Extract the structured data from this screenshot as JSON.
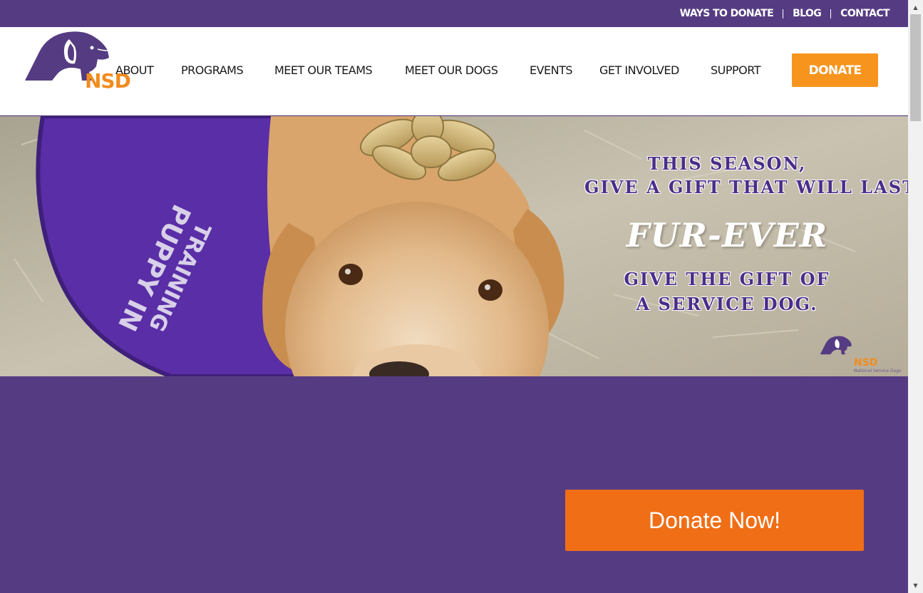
{
  "brand": {
    "logo_text": "NSD",
    "hero_logo_text": "NSD",
    "hero_logo_subtext": "National Service Dogs",
    "colors": {
      "purple": "#553c82",
      "orange": "#f7941d",
      "cta_orange": "#f06e16"
    }
  },
  "utility_nav": {
    "items": [
      {
        "label": "WAYS TO DONATE"
      },
      {
        "label": "BLOG"
      },
      {
        "label": "CONTACT"
      }
    ]
  },
  "main_nav": {
    "items": [
      {
        "label": "ABOUT"
      },
      {
        "label": "PROGRAMS"
      },
      {
        "label": "MEET OUR TEAMS"
      },
      {
        "label": "MEET OUR DOGS"
      },
      {
        "label": "EVENTS"
      },
      {
        "label": "GET INVOLVED"
      },
      {
        "label": "SUPPORT"
      }
    ],
    "donate_label": "DONATE"
  },
  "hero": {
    "line1": "THIS SEASON,",
    "line2": "GIVE A GIFT THAT WILL LAST",
    "highlight": "FUR-EVER",
    "line3": "GIVE THE GIFT OF",
    "line4": "A SERVICE DOG.",
    "vest_text_1": "PUPPY IN",
    "vest_text_2": "TRAINING"
  },
  "cta": {
    "donate_now_label": "Donate Now!"
  },
  "scrollbar": {
    "up_icon": "▲",
    "down_icon": "▼"
  }
}
